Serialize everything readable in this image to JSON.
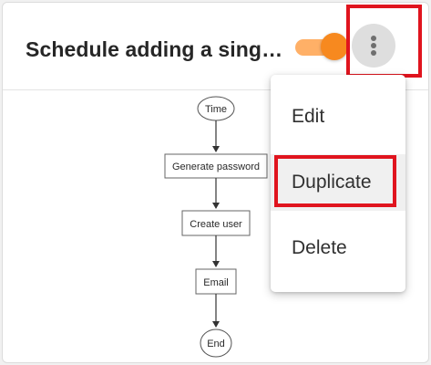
{
  "card": {
    "title": "Schedule adding a single user",
    "toggle_on": true
  },
  "menu": {
    "items": [
      {
        "label": "Edit"
      },
      {
        "label": "Duplicate"
      },
      {
        "label": "Delete"
      }
    ]
  },
  "flow": {
    "start": "Time",
    "steps": [
      "Generate password",
      "Create user",
      "Email"
    ],
    "end": "End"
  },
  "colors": {
    "accent": "#f7891f",
    "toggle_track": "#ffb067",
    "highlight": "#e0141e"
  },
  "icons": {
    "more": "more-vertical-icon"
  }
}
